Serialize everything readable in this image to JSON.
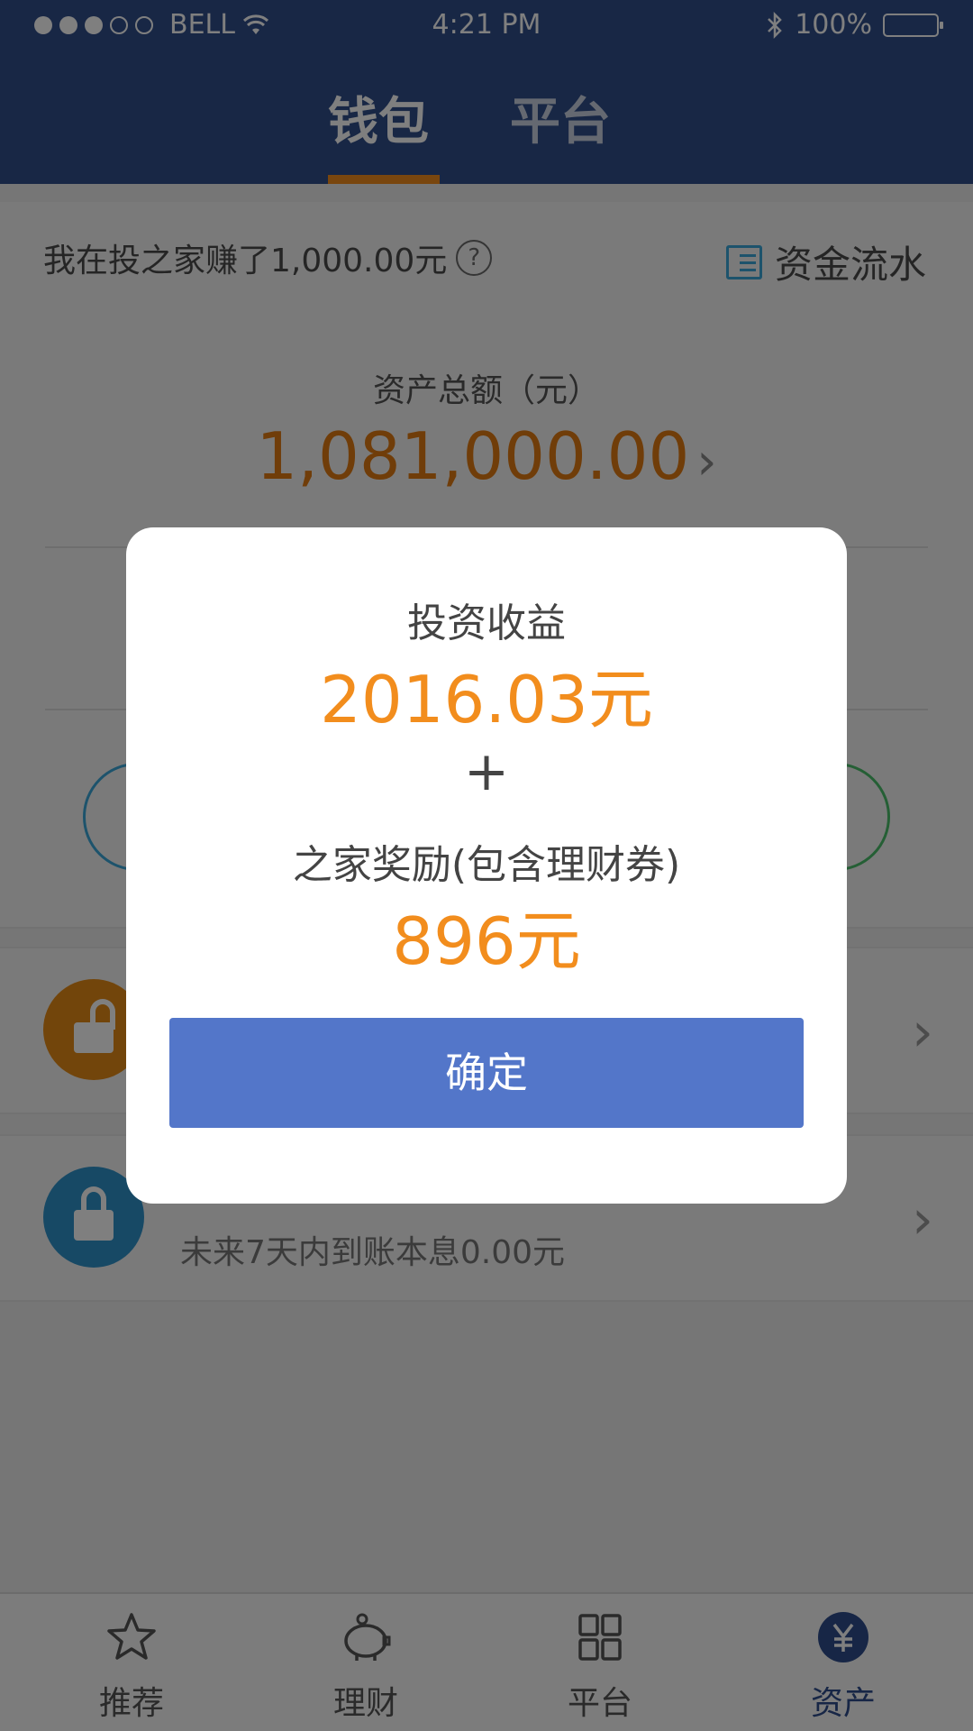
{
  "status_bar": {
    "carrier": "BELL",
    "time": "4:21 PM",
    "battery": "100%"
  },
  "header": {
    "tabs": [
      {
        "label": "钱包",
        "active": true
      },
      {
        "label": "平台",
        "active": false
      }
    ]
  },
  "wallet": {
    "earned_text": "我在投之家赚了1,000.00元",
    "help_symbol": "?",
    "fund_flow_label": "资金流水",
    "total_label": "资产总额（元）",
    "total_amount": "1,081,000.00",
    "chevron": "›"
  },
  "rows": [
    {
      "icon": "unlock-icon",
      "chevron": "›"
    },
    {
      "icon": "lock-icon",
      "subtitle": "未来7天内到账本息0.00元",
      "chevron": "›"
    }
  ],
  "bottom_nav": [
    {
      "label": "推荐",
      "icon": "star-icon",
      "active": false
    },
    {
      "label": "理财",
      "icon": "piggy-bank-icon",
      "active": false
    },
    {
      "label": "平台",
      "icon": "grid-icon",
      "active": false
    },
    {
      "label": "资产",
      "icon": "yuan-icon",
      "active": true
    }
  ],
  "modal": {
    "title": "投资收益",
    "investment_income": "2016.03元",
    "plus": "+",
    "reward_title": "之家奖励(包含理财券)",
    "reward_amount": "896元",
    "confirm_label": "确定"
  },
  "colors": {
    "header": "#314e8b",
    "accent_orange": "#f28d1d",
    "button_blue": "#5376c9"
  }
}
